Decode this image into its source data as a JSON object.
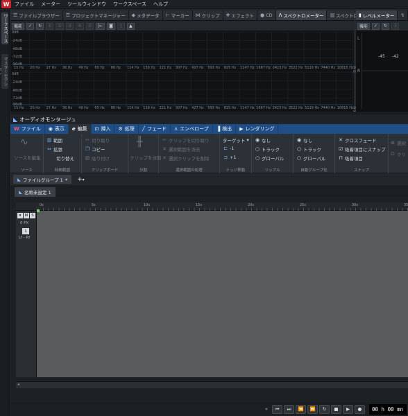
{
  "app": {
    "logo": "W"
  },
  "menu": [
    "ファイル",
    "メーター",
    "ツールウィンドウ",
    "ワークスペース",
    "ヘルプ"
  ],
  "left_strip": [
    "ワークスペース",
    "マスターセクション"
  ],
  "top_tabs": [
    {
      "label": "ファイルブラウザー",
      "icon": "list-icon"
    },
    {
      "label": "プロジェクトマネージャー",
      "icon": "list-icon"
    },
    {
      "label": "メタデータ",
      "icon": "tag-icon"
    },
    {
      "label": "マーカー",
      "icon": "marker-icon"
    },
    {
      "label": "クリップ",
      "icon": "clip-icon"
    },
    {
      "label": "エフェクト",
      "icon": "effect-icon"
    },
    {
      "label": "CD",
      "icon": "cd-icon"
    },
    {
      "label": "スペクトロメーター",
      "icon": "spectro-icon",
      "active": true
    },
    {
      "label": "スペクトロスコープ",
      "icon": "bars-icon"
    }
  ],
  "spec_toolbar": {
    "func_label": "機能"
  },
  "spectro": {
    "db_labels_top": [
      "0dB",
      "-24dB",
      "-48dB",
      "-72dB",
      "-96dB"
    ],
    "db_labels_bottom": [
      "0dB",
      "-24dB",
      "-48dB",
      "-72dB",
      "-96dB"
    ],
    "hz_labels": [
      "15 Hz",
      "20 Hz",
      "27 Hz",
      "36 Hz",
      "49 Hz",
      "65 Hz",
      "86 Hz",
      "114 Hz",
      "159 Hz",
      "221 Hz",
      "307 Hz",
      "427 Hz",
      "593 Hz",
      "825 Hz",
      "1147 Hz",
      "1667 Hz",
      "2423 Hz",
      "3522 Hz",
      "5119 Hz",
      "7440 Hz",
      "10815 Hz",
      "16436 Hz"
    ]
  },
  "level_meter": {
    "tab_label": "レベルメーター",
    "func_label": "機能",
    "ch_l": "L",
    "ch_r": "R",
    "val_a": "-45",
    "val_b": "-42"
  },
  "audio_montage": {
    "title": "オーディオモンタージュ"
  },
  "ribbon_tabs": [
    {
      "label": "ファイル",
      "icon": "logo-icon"
    },
    {
      "label": "表示",
      "icon": "eye-icon"
    },
    {
      "label": "編集",
      "icon": "edit-icon",
      "active": true
    },
    {
      "label": "挿入",
      "icon": "insert-icon"
    },
    {
      "label": "処理",
      "icon": "process-icon"
    },
    {
      "label": "フェード",
      "icon": "fade-icon"
    },
    {
      "label": "エンベロープ",
      "icon": "envelope-icon"
    },
    {
      "label": "検出",
      "icon": "detect-icon"
    },
    {
      "label": "レンダリング",
      "icon": "render-icon"
    }
  ],
  "ribbon": {
    "source": {
      "label": "ソースを編集",
      "caption": "ソース"
    },
    "timerange": {
      "range": "範囲",
      "expand": "拡張",
      "swap": "切り替え",
      "caption": "時間範囲"
    },
    "clipboard": {
      "cut": "切り取り",
      "copy": "コピー",
      "paste": "貼り付け",
      "caption": "クリップボード"
    },
    "split": {
      "label": "クリップを分割",
      "caption": "分割"
    },
    "selection": {
      "cut": "クリップを切り取り",
      "delete_range": "選択範囲を消去",
      "delete_clip": "選択クリップを削除",
      "caption": "選択範囲の処理"
    },
    "nudge": {
      "target": "ターゲット",
      "minus": "-1",
      "plus": "+1",
      "caption": "ナッジ移動"
    },
    "ripple": {
      "none": "なし",
      "track": "トラック",
      "global": "グローバル",
      "caption": "リップル"
    },
    "autogroup": {
      "none": "なし",
      "track": "トラック",
      "global": "グローバル",
      "caption": "自動グループ化"
    },
    "snap": {
      "crossfade": "クロスフェード",
      "snap_to": "吸着項目にスナップ",
      "snap_item": "吸着項目",
      "caption": "スナップ"
    },
    "extra": {
      "select": "選択",
      "clip": "クリ"
    }
  },
  "doc_tab": {
    "label": "ファイルグループ 1",
    "add": "+"
  },
  "sub_tab": {
    "label": "名称未設定 1"
  },
  "track": {
    "buttons": [
      "M",
      "S"
    ],
    "fx": "0 FX",
    "num": "1",
    "pan": "Lf - Rf"
  },
  "ruler": [
    "0s",
    "5s",
    "10s",
    "15s",
    "20s",
    "25s",
    "30s",
    "35s"
  ],
  "transport": {
    "timecode": "00 h 00 mn"
  }
}
